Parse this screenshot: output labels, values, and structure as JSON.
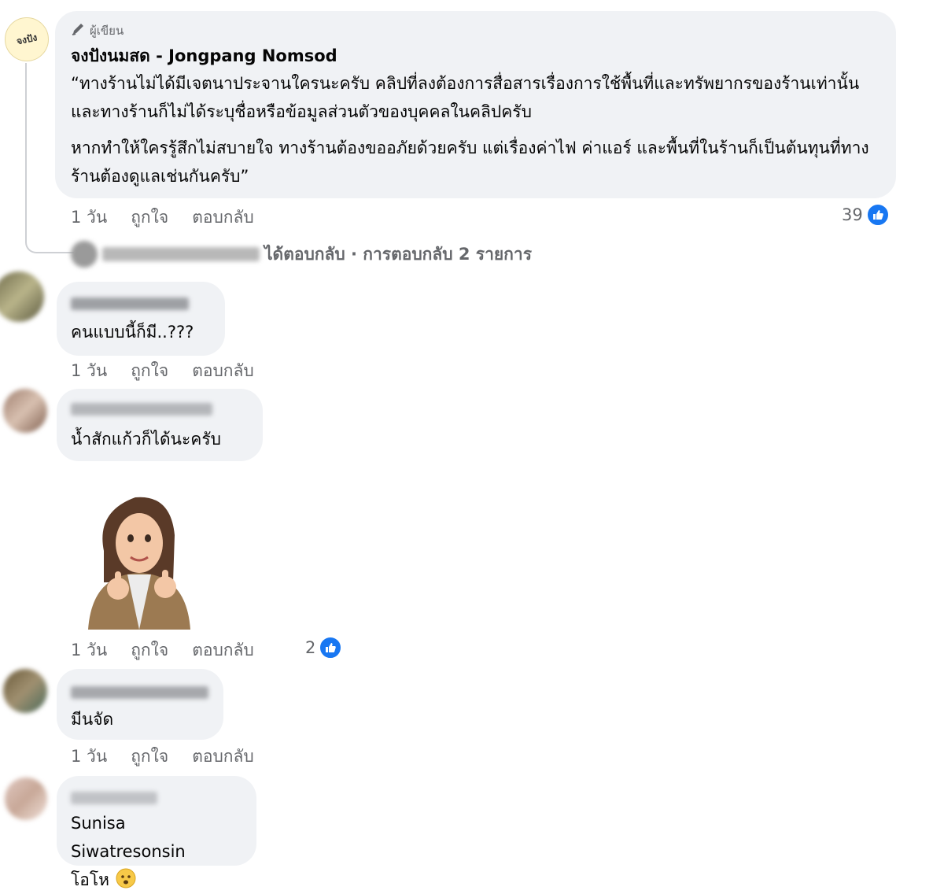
{
  "page_author": {
    "avatar_text": "จงปัง",
    "badge": "ผู้เขียน",
    "name": "จงปังนมสด - Jongpang Nomsod",
    "paragraph1": "“ทางร้านไม่ได้มีเจตนาประจานใครนะครับ คลิปที่ลงต้องการสื่อสารเรื่องการใช้พื้นที่และทรัพยากรของร้านเท่านั้น และทางร้านก็ไม่ได้ระบุชื่อหรือข้อมูลส่วนตัวของบุคคลในคลิปครับ",
    "paragraph2": "หากทำให้ใครรู้สึกไม่สบายใจ ทางร้านต้องขออภัยด้วยครับ แต่เรื่องค่าไฟ ค่าแอร์ และพื้นที่ในร้านก็เป็นต้นทุนที่ทางร้านต้องดูแลเช่นกันครับ”",
    "time": "1 วัน",
    "like": "ถูกใจ",
    "reply": "ตอบกลับ",
    "like_count": "39"
  },
  "replies_summary": "ได้ตอบกลับ · การตอบกลับ 2 รายการ",
  "comments": [
    {
      "text": "คนแบบนี้ก็มี..???",
      "time": "1 วัน",
      "like": "ถูกใจ",
      "reply": "ตอบกลับ"
    },
    {
      "text": "น้ำสักแก้วก็ได้นะครับ"
    },
    {
      "time": "1 วัน",
      "like": "ถูกใจ",
      "reply": "ตอบกลับ",
      "like_count": "2"
    },
    {
      "text": "มีนจัด",
      "time": "1 วัน",
      "like": "ถูกใจ",
      "reply": "ตอบกลับ"
    },
    {
      "mention": "Sunisa Siwatresonsin",
      "text": "โอโห"
    }
  ],
  "colors": {
    "bubble": "#f0f2f5",
    "meta": "#65676b",
    "like_blue": "#1877f2"
  },
  "icons": [
    "pen-icon",
    "like-thumb-icon",
    "emoji-face-icon"
  ]
}
